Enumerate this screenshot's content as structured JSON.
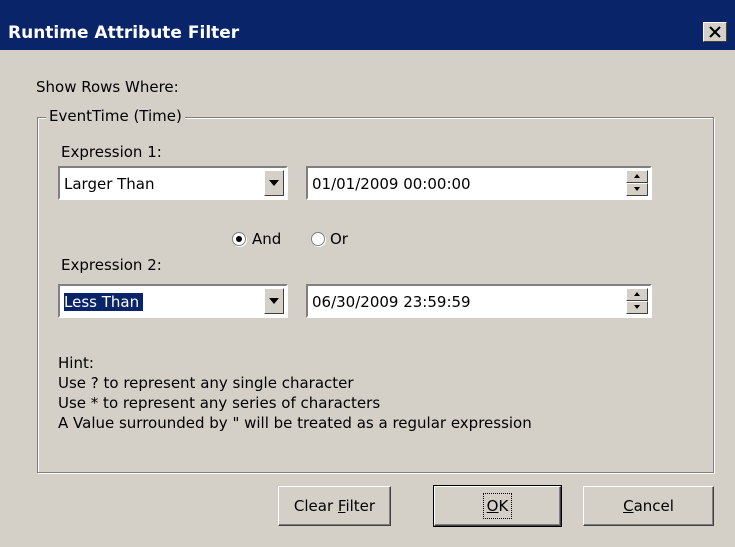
{
  "window": {
    "title": "Runtime Attribute Filter"
  },
  "filter": {
    "show_rows_label": "Show Rows Where:",
    "group_label": "EventTime (Time)",
    "expression1": {
      "label": "Expression 1:",
      "operator": "Larger Than",
      "value": "01/01/2009 00:00:00"
    },
    "logic": {
      "and_label": "And",
      "or_label": "Or",
      "selected": "And"
    },
    "expression2": {
      "label": "Expression 2:",
      "operator": "Less Than",
      "value": "06/30/2009 23:59:59"
    },
    "hint": {
      "title": "Hint:",
      "lines": [
        "Use ? to represent any single character",
        "Use * to represent any series of characters",
        "A Value surrounded by \" will be treated as a regular expression"
      ]
    }
  },
  "buttons": {
    "clear_pre": "Clear ",
    "clear_key": "F",
    "clear_post": "ilter",
    "ok_key": "O",
    "ok_post": "K",
    "cancel_key": "C",
    "cancel_post": "ancel"
  }
}
